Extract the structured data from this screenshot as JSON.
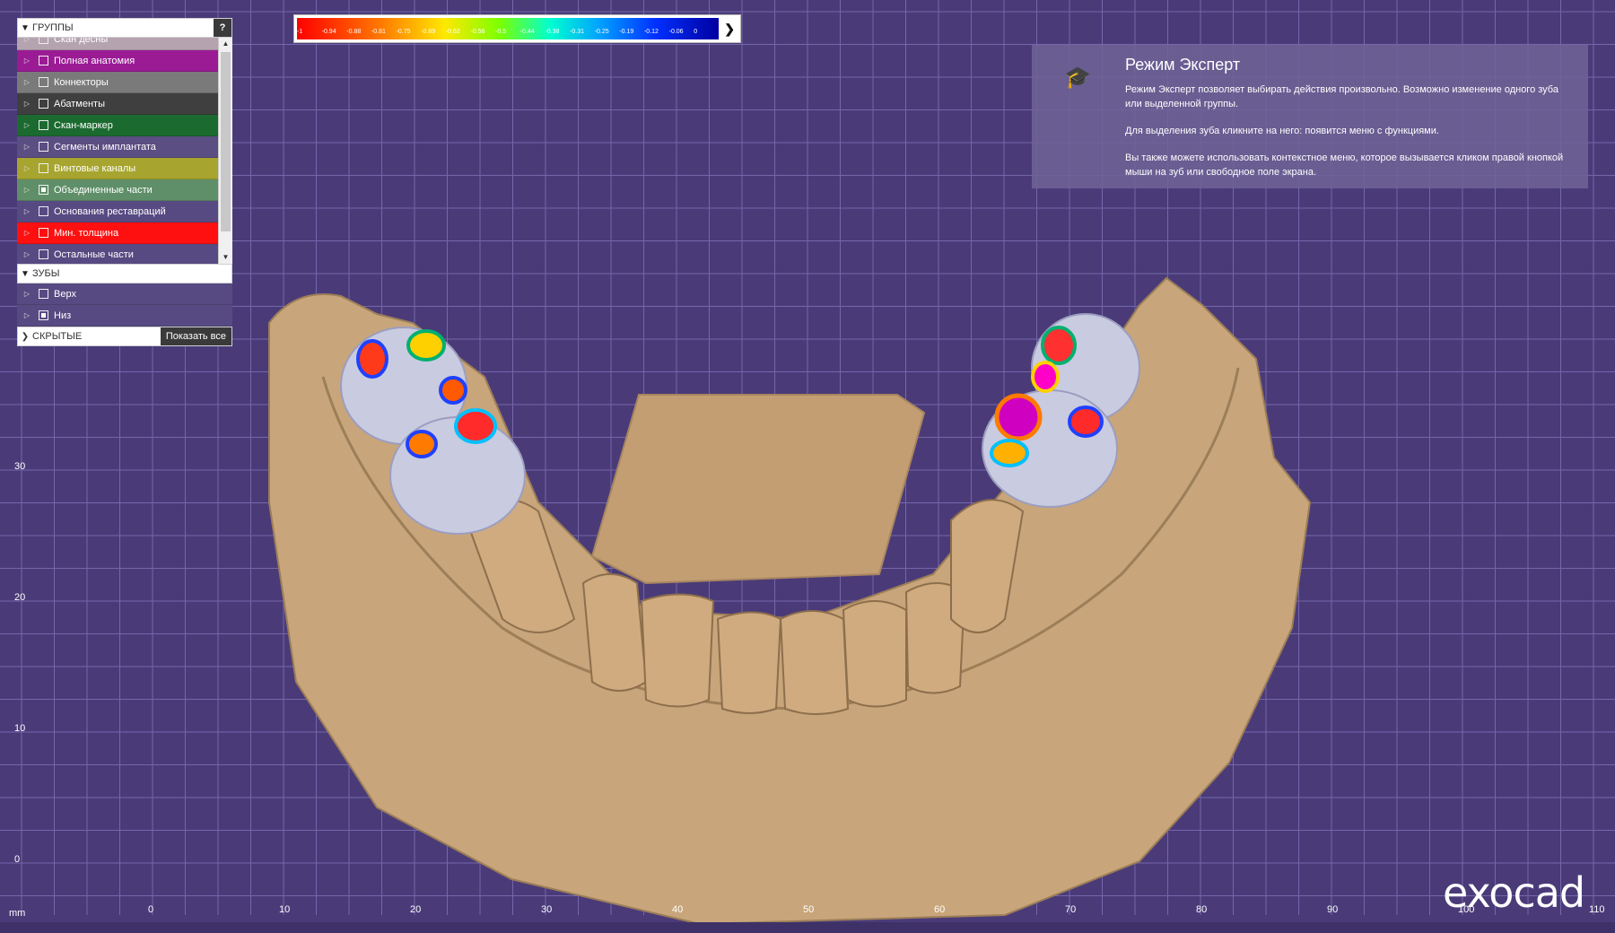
{
  "panel": {
    "groups_header": "ГРУППЫ",
    "help_label": "?",
    "groups": [
      {
        "label": "Скан десны",
        "color": "#b6a3b0",
        "checked": false
      },
      {
        "label": "Полная анатомия",
        "color": "#9b1b95",
        "checked": false
      },
      {
        "label": "Коннекторы",
        "color": "#7a7a7a",
        "checked": false
      },
      {
        "label": "Абатменты",
        "color": "#3f3f3f",
        "checked": false
      },
      {
        "label": "Скан-маркер",
        "color": "#1b6a2f",
        "checked": false
      },
      {
        "label": "Сегменты имплантата",
        "color": "#5a4e82",
        "checked": false
      },
      {
        "label": "Винтовые каналы",
        "color": "#a7a52f",
        "checked": false
      },
      {
        "label": "Объединенные части",
        "color": "#5f8f68",
        "checked": true
      },
      {
        "label": "Основания реставраций",
        "color": "#574a82",
        "checked": false
      },
      {
        "label": "Мин. толщина",
        "color": "#ff1010",
        "checked": false
      },
      {
        "label": "Остальные части",
        "color": "#574a82",
        "checked": false
      }
    ],
    "teeth_header": "ЗУБЫ",
    "teeth": [
      {
        "label": "Верх",
        "checked": false
      },
      {
        "label": "Низ",
        "checked": true
      }
    ],
    "hidden_header": "СКРЫТЫЕ",
    "show_all_label": "Показать все"
  },
  "scale": {
    "ticks": [
      "-1",
      "-0.94",
      "-0.88",
      "-0.81",
      "-0.75",
      "-0.69",
      "-0.62",
      "-0.56",
      "-0.5",
      "-0.44",
      "-0.38",
      "-0.31",
      "-0.25",
      "-0.19",
      "-0.12",
      "-0.06",
      "0"
    ],
    "next_icon": "chevron-right-icon"
  },
  "info": {
    "icon": "graduation-cap-icon",
    "title": "Режим Эксперт",
    "p1": "Режим Эксперт позволяет выбирать действия произвольно. Возможно изменение одного зуба или выделенной группы.",
    "p2": "Для выделения зуба кликните на него: появится меню с функциями.",
    "p3": "Вы также можете использовать контекстное меню, которое вызывается кликом правой кнопкой мыши на зуб или свободное поле экрана."
  },
  "axes": {
    "unit": "mm",
    "x_labels": [
      "0",
      "10",
      "20",
      "30",
      "40",
      "50",
      "60",
      "70",
      "80",
      "90",
      "100",
      "110"
    ],
    "y_labels": [
      "30",
      "20",
      "10",
      "0"
    ]
  },
  "logo": "exocad",
  "colors": {
    "background": "#4a3b78",
    "model": "#c8a57a"
  }
}
